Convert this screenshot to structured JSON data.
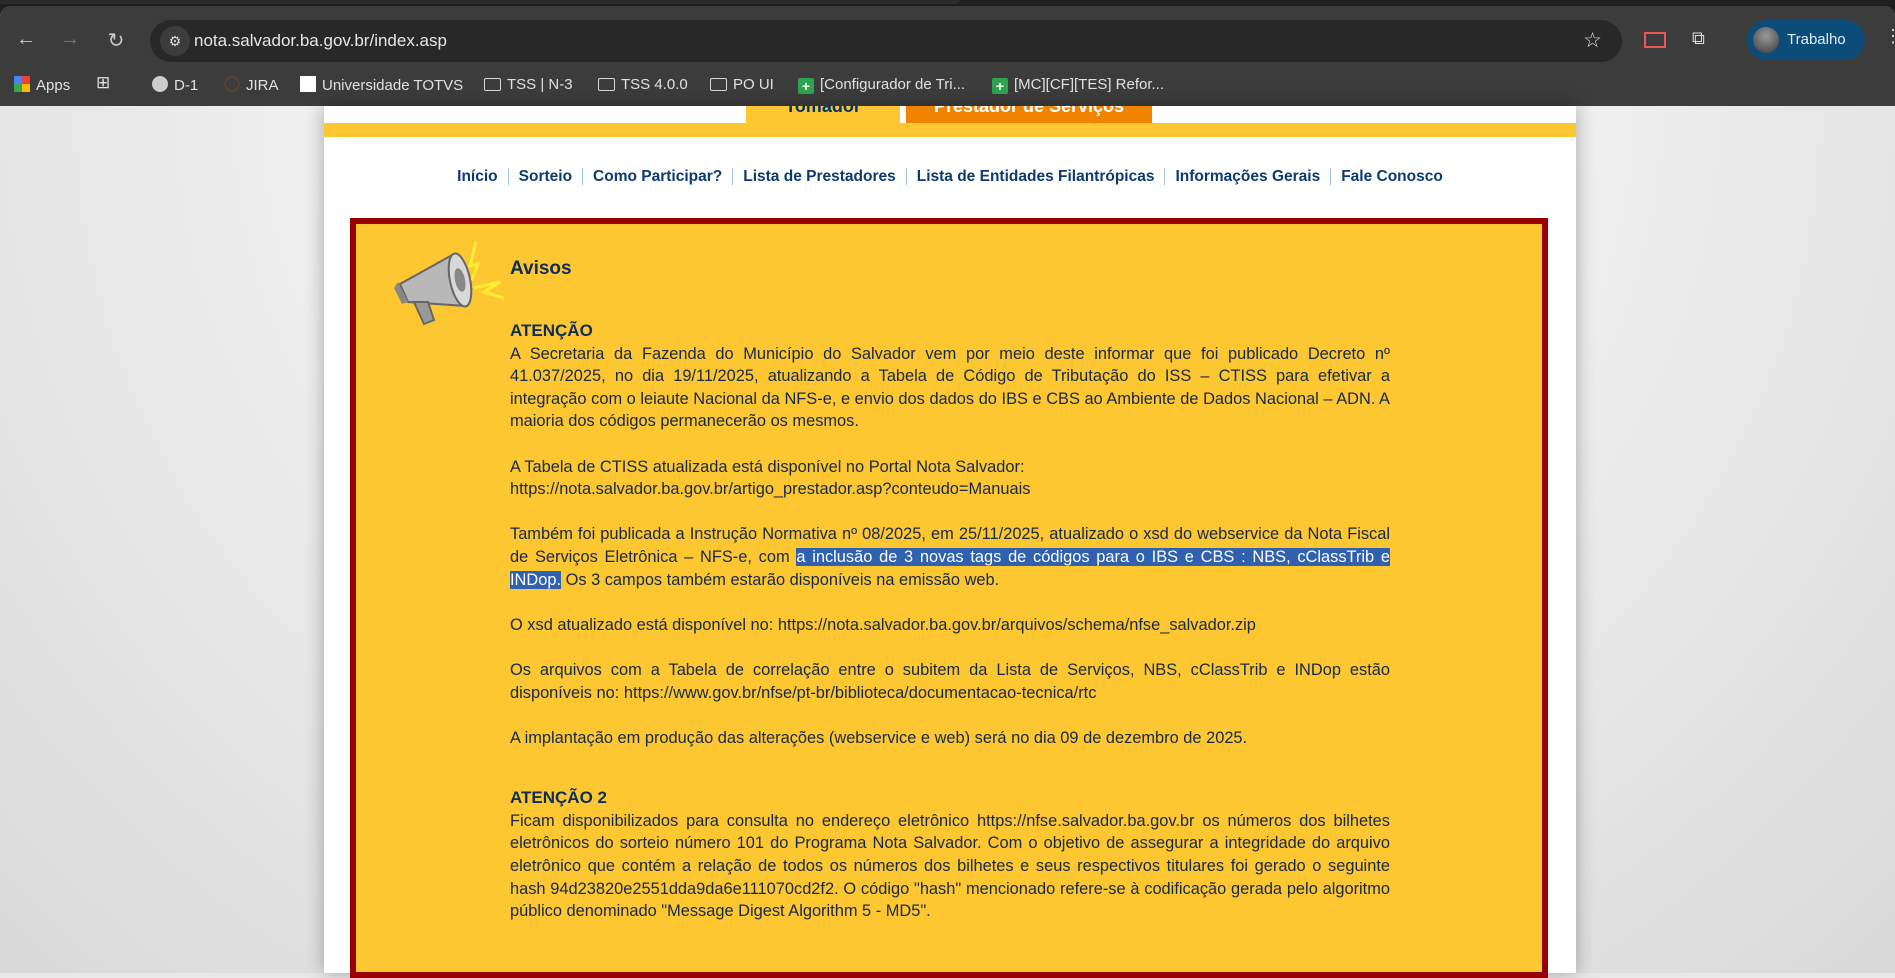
{
  "browser": {
    "url": "nota.salvador.ba.gov.br/index.asp",
    "profile": "Trabalho",
    "bookmarks": [
      "Apps",
      "D-1",
      "JIRA",
      "Universidade TOTVS",
      "TSS | N-3",
      "TSS 4.0.0",
      "PO UI",
      "[Configurador de Tri...",
      "[MC][CF][TES] Refor..."
    ]
  },
  "site": {
    "tabs": [
      "Tomador",
      "Prestador de Serviços"
    ],
    "nav": [
      "Início",
      "Sorteio",
      "Como Participar?",
      "Lista de Prestadores",
      "Lista de Entidades Filantrópicas",
      "Informações Gerais",
      "Fale Conosco"
    ],
    "colors": {
      "border": "#990000",
      "panel": "#fdc732",
      "orange": "#f08300",
      "text": "#17284a"
    }
  },
  "avisos": {
    "title": "Avisos",
    "att1": "ATENÇÃO",
    "p1": "A Secretaria da Fazenda do Município do Salvador vem por meio deste informar que foi publicado Decreto nº 41.037/2025, no dia 19/11/2025, atualizando a Tabela de Código de Tributação do ISS – CTISS para efetivar a integração com o leiaute Nacional da NFS-e, e envio dos dados do IBS e CBS ao Ambiente de Dados Nacional – ADN. A maioria dos códigos permanecerão os mesmos.",
    "p2a": "A Tabela de CTISS atualizada está disponível no Portal Nota Salvador:",
    "p2b": "https://nota.salvador.ba.gov.br/artigo_prestador.asp?conteudo=Manuais",
    "p3a": "Também foi publicada a Instrução Normativa nº 08/2025, em 25/11/2025, atualizado o xsd do webservice da Nota Fiscal de Serviços Eletrônica – NFS-e, com ",
    "p3sel": "a inclusão de 3 novas tags de códigos para o IBS e CBS : NBS, cClassTrib e INDop.",
    "p3b": " Os 3 campos também estarão disponíveis na emissão web.",
    "p4": "O xsd atualizado está disponível no: https://nota.salvador.ba.gov.br/arquivos/schema/nfse_salvador.zip",
    "p5": "Os arquivos com a Tabela de correlação entre o subitem da Lista de Serviços, NBS, cClassTrib e INDop estão disponíveis no: https://www.gov.br/nfse/pt-br/biblioteca/documentacao-tecnica/rtc",
    "p6": "A implantação em produção das alterações (webservice e web) será no dia 09 de dezembro de 2025.",
    "att2": "ATENÇÃO 2",
    "p7": "Ficam disponibilizados para consulta no endereço eletrônico https://nfse.salvador.ba.gov.br os números dos bilhetes eletrônicos do sorteio número 101 do Programa Nota Salvador. Com o objetivo de assegurar a integridade do arquivo eletrônico que contém a relação de todos os números dos bilhetes e seus respectivos titulares foi gerado o seguinte hash 94d23820e2551dda9da6e111070cd2f2. O código \"hash\" mencionado refere-se à codificação gerada pelo algoritmo público denominado \"Message Digest Algorithm 5 - MD5\"."
  }
}
